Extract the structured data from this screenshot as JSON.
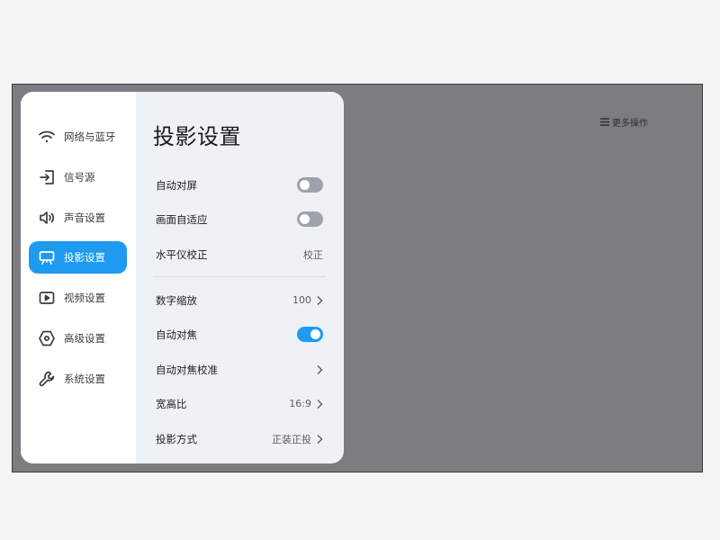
{
  "top_bar": {
    "more_ops_label": "更多操作",
    "more_ops_icon": "menu-icon"
  },
  "colors": {
    "accent": "#1e9bf0",
    "screen_bg": "#7c7d80",
    "panel_bg": "#eef1f6",
    "toggle_off": "#9ea2aa"
  },
  "sidebar": {
    "items": [
      {
        "label": "网络与蓝牙",
        "icon": "wifi-icon",
        "active": false
      },
      {
        "label": "信号源",
        "icon": "input-source-icon",
        "active": false
      },
      {
        "label": "声音设置",
        "icon": "speaker-icon",
        "active": false
      },
      {
        "label": "投影设置",
        "icon": "projector-icon",
        "active": true
      },
      {
        "label": "视频设置",
        "icon": "video-icon",
        "active": false
      },
      {
        "label": "高级设置",
        "icon": "hexagon-settings-icon",
        "active": false
      },
      {
        "label": "系统设置",
        "icon": "wrench-icon",
        "active": false
      }
    ]
  },
  "main": {
    "title": "投影设置",
    "rows": [
      {
        "label": "自动对屏",
        "type": "toggle",
        "on": false
      },
      {
        "label": "画面自适应",
        "type": "toggle",
        "on": false
      },
      {
        "label": "水平仪校正",
        "type": "action",
        "value": "校正"
      },
      {
        "label": "数字缩放",
        "type": "nav",
        "value": "100"
      },
      {
        "label": "自动对焦",
        "type": "toggle",
        "on": true
      },
      {
        "label": "自动对焦校准",
        "type": "nav",
        "value": ""
      },
      {
        "label": "宽高比",
        "type": "nav",
        "value": "16:9"
      },
      {
        "label": "投影方式",
        "type": "nav",
        "value": "正装正投"
      }
    ]
  }
}
